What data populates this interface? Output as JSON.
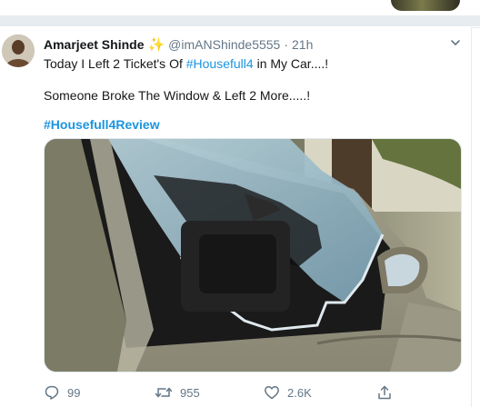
{
  "tweet": {
    "author_name": "Amarjeet Shinde",
    "author_badge": "✨",
    "handle": "@imANShinde5555",
    "separator": "·",
    "time": "21h",
    "line1_prefix": "Today I Left 2 Ticket's Of ",
    "line1_hashtag": "#Housefull4",
    "line1_suffix": " in My Car....!",
    "line2": "Someone Broke The Window & Left 2 More.....!",
    "hashtag_line": "#Housefull4Review",
    "media_description_icon": "photo-broken-car-window"
  },
  "actions": {
    "reply_count": "99",
    "retweet_count": "955",
    "like_count": "2.6K",
    "share_icon": "share-icon"
  },
  "colors": {
    "link": "#1b95e0",
    "secondary_text": "#657786",
    "badge": "#f5a623"
  }
}
